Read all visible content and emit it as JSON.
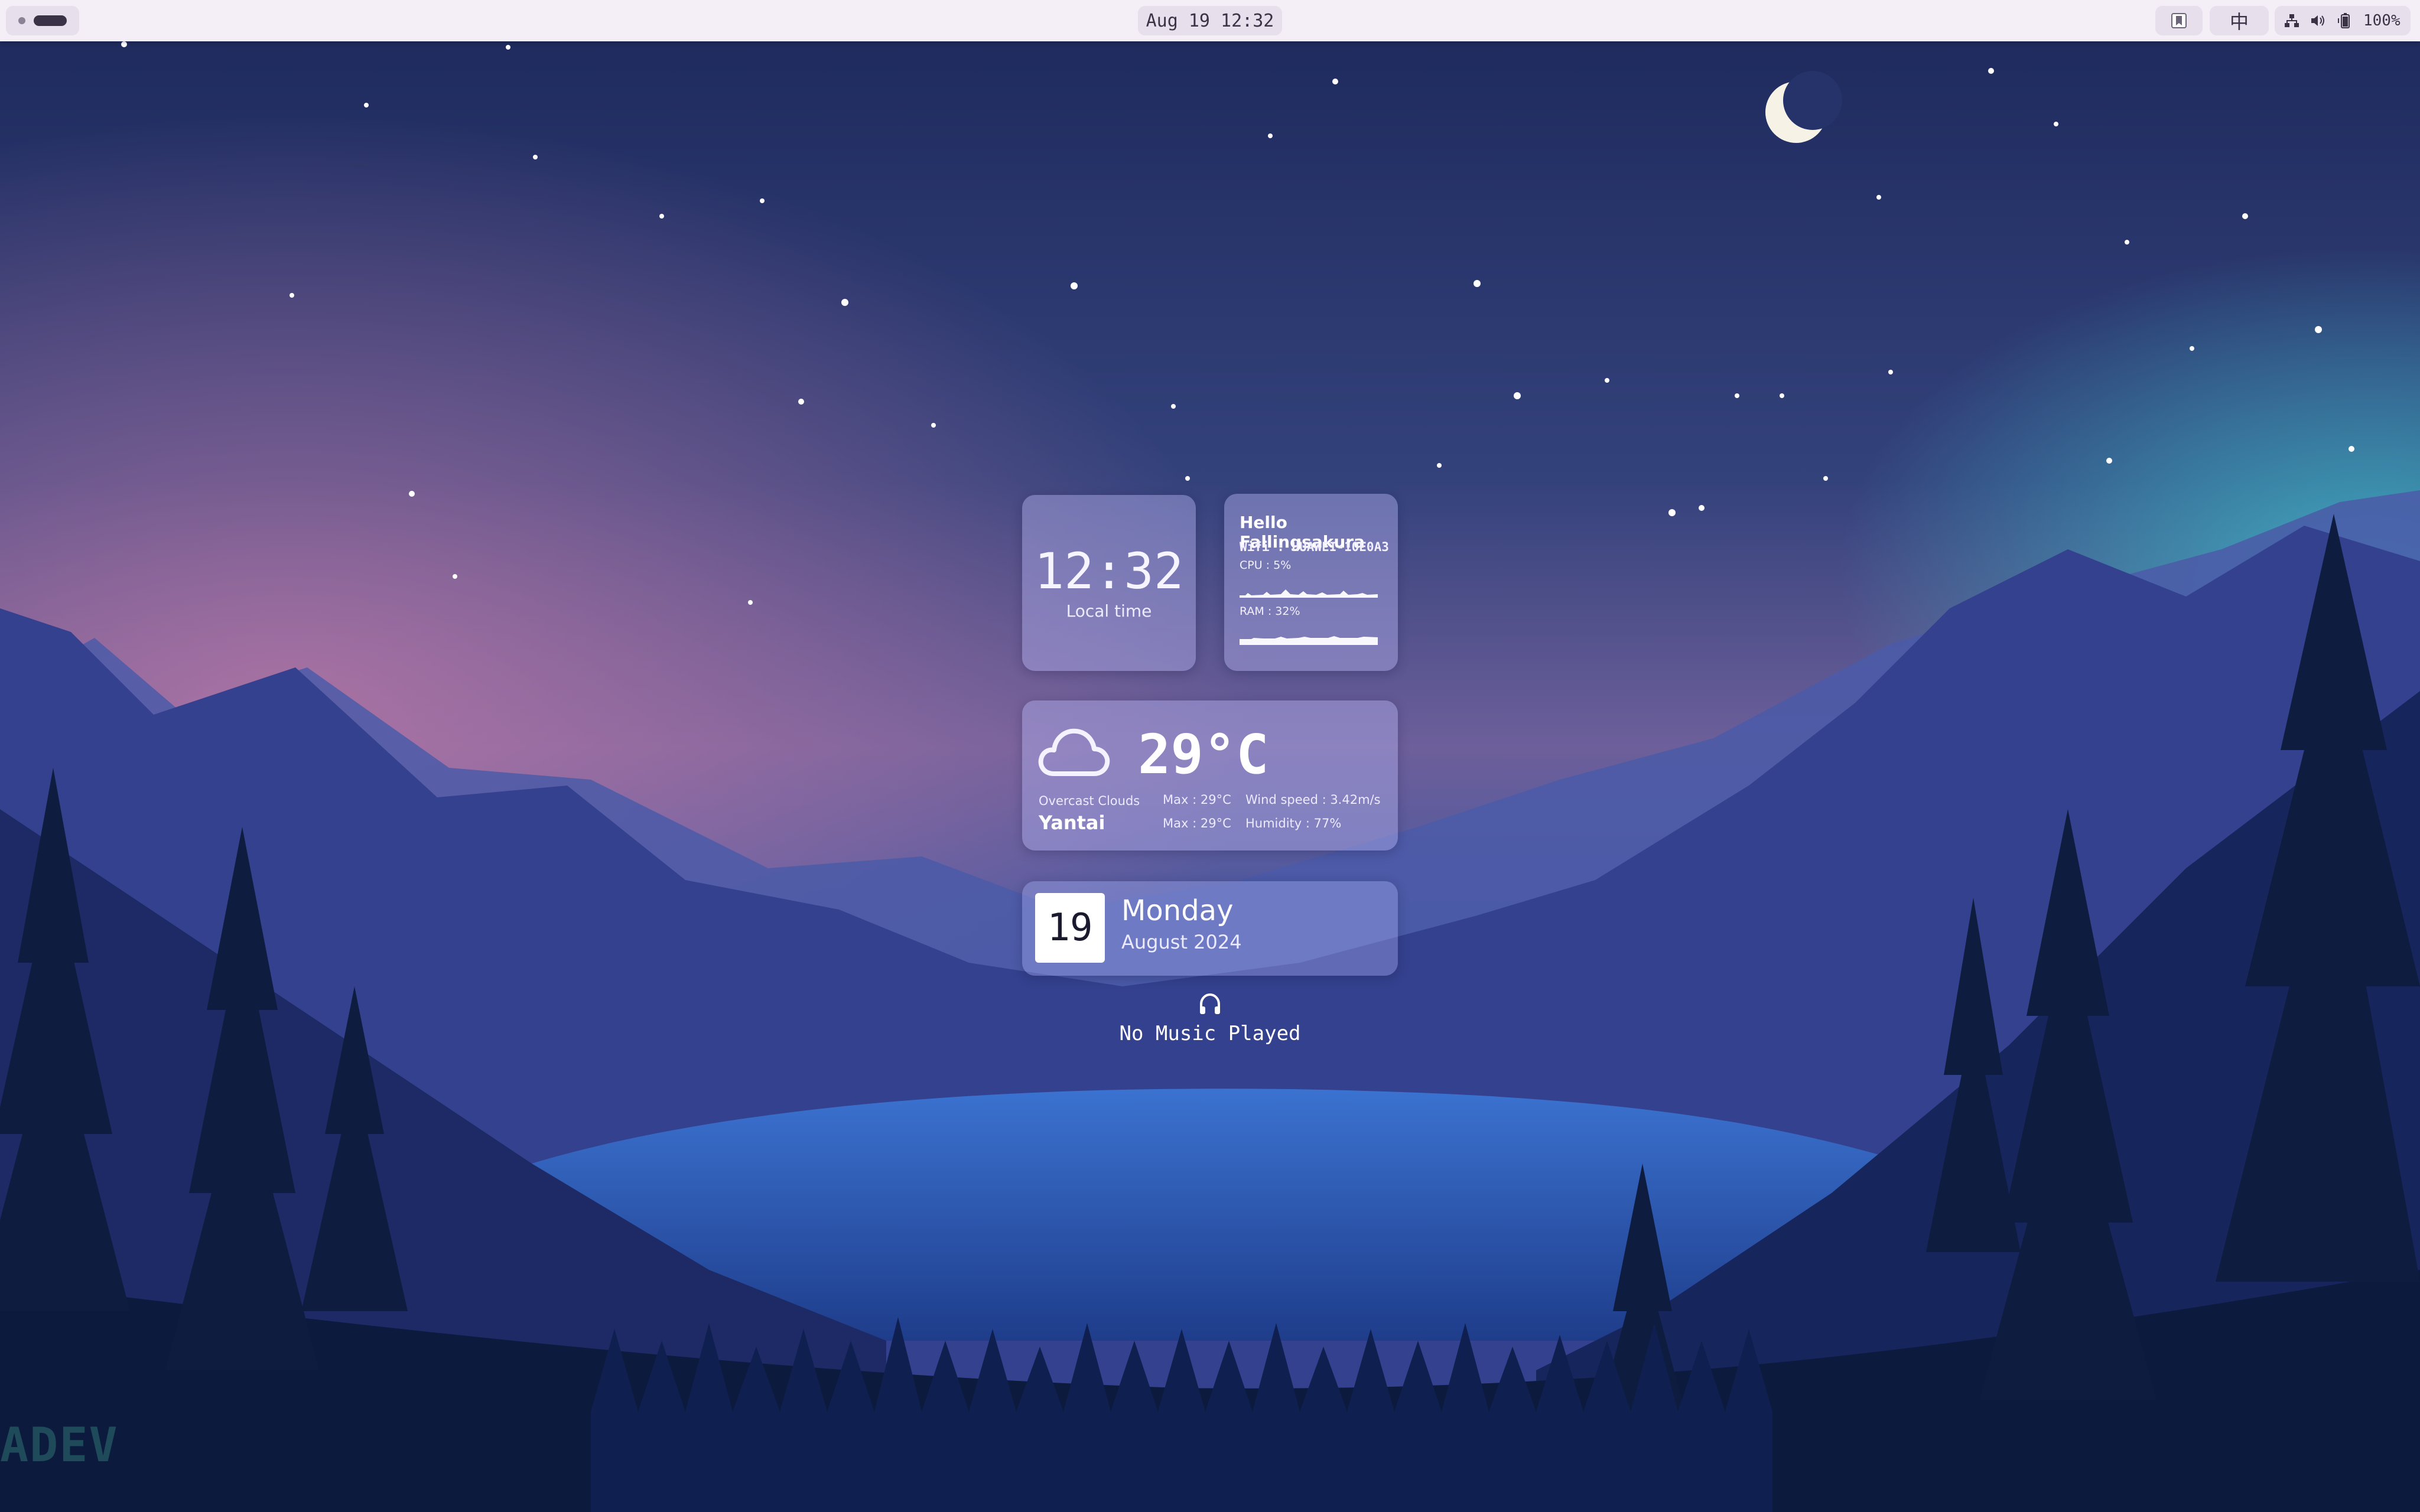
{
  "topbar": {
    "datetime": "Aug 19 12:32",
    "input_method": "中",
    "battery": "100%",
    "icons": [
      "workspace-indicator",
      "bookmark-icon",
      "network-icon",
      "volume-icon",
      "battery-icon"
    ]
  },
  "clock_widget": {
    "time": "12:32",
    "label": "Local time"
  },
  "system_widget": {
    "greeting": "Hello Fallingsakura",
    "wifi": "Wifi :  HUAWEI-10E0A3",
    "cpu": "CPU : 5%",
    "ram": "RAM : 32%"
  },
  "weather_widget": {
    "icon": "cloud-icon",
    "temperature": "29°C",
    "description": "Overcast Clouds",
    "city": "Yantai",
    "max_1": "Max : 29°C",
    "max_2": "Max : 29°C",
    "wind": "Wind speed : 3.42m/s",
    "humidity": "Humidity : 77%"
  },
  "date_widget": {
    "day_number": "19",
    "weekday": "Monday",
    "month_year": "August 2024"
  },
  "music_widget": {
    "icon": "headphones-icon",
    "status": "No Music Played"
  },
  "watermark": "ADEV",
  "colors": {
    "topbar_bg": "#f4eff7",
    "pill_bg": "#e7e0ec",
    "card_bg": "rgba(178,176,238,0.45)",
    "sky_top": "#1e2a5c",
    "sky_pink": "#8a5a8e"
  }
}
